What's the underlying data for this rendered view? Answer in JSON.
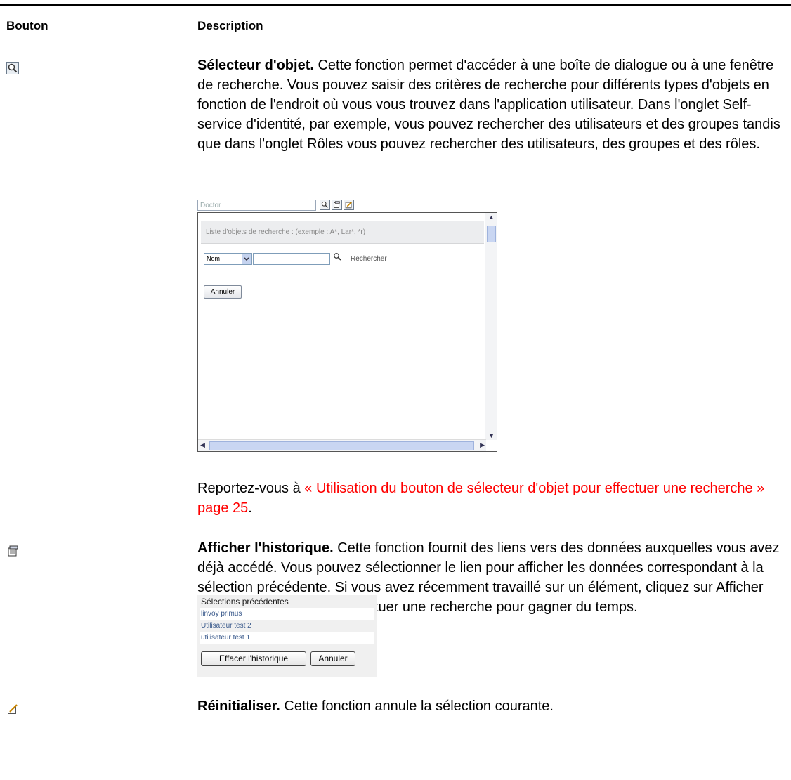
{
  "table": {
    "col1_header": "Bouton",
    "col2_header": "Description"
  },
  "rows": [
    {
      "icon": "magnifier-icon",
      "title": "Sélecteur d'objet.",
      "text": " Cette fonction permet d'accéder à une boîte de dialogue ou à une fenêtre de recherche. Vous pouvez saisir des critères de recherche pour différents types d'objets en fonction de l'endroit où vous vous trouvez dans l'application utilisateur. Dans l'onglet Self-service d'identité, par exemple, vous pouvez rechercher des utilisateurs et des groupes tandis que dans l'onglet Rôles vous pouvez rechercher des utilisateurs, des groupes et des rôles.",
      "ref_prefix": "Reportez-vous à ",
      "ref_link": "« Utilisation du bouton de sélecteur d'objet pour effectuer une recherche » page 25",
      "ref_suffix": "."
    },
    {
      "icon": "history-icon",
      "title": "Afficher l'historique.",
      "text": " Cette fonction fournit des liens vers des données auxquelles vous avez déjà accédé. Vous pouvez sélectionner le lien pour afficher les données correspondant à la sélection précédente. Si vous avez récemment travaillé sur un élément, cliquez sur Afficher l'historique plutôt que d'effectuer une recherche pour gagner du temps."
    },
    {
      "icon": "reset-icon",
      "title": "Réinitialiser.",
      "text": " Cette fonction annule la sélection courante."
    }
  ],
  "object_selector": {
    "input_value": "Doctor",
    "bar_text": "Liste d'objets de recherche : (exemple : A*, Lar*, *r)",
    "select_value": "Nom",
    "search_label": "Rechercher",
    "cancel_label": "Annuler"
  },
  "history": {
    "title": "Sélections précédentes",
    "items": [
      "linvoy primus",
      "Utilisateur test 2",
      "utilisateur test 1"
    ],
    "clear_label": "Effacer l'historique",
    "cancel_label": "Annuler"
  }
}
